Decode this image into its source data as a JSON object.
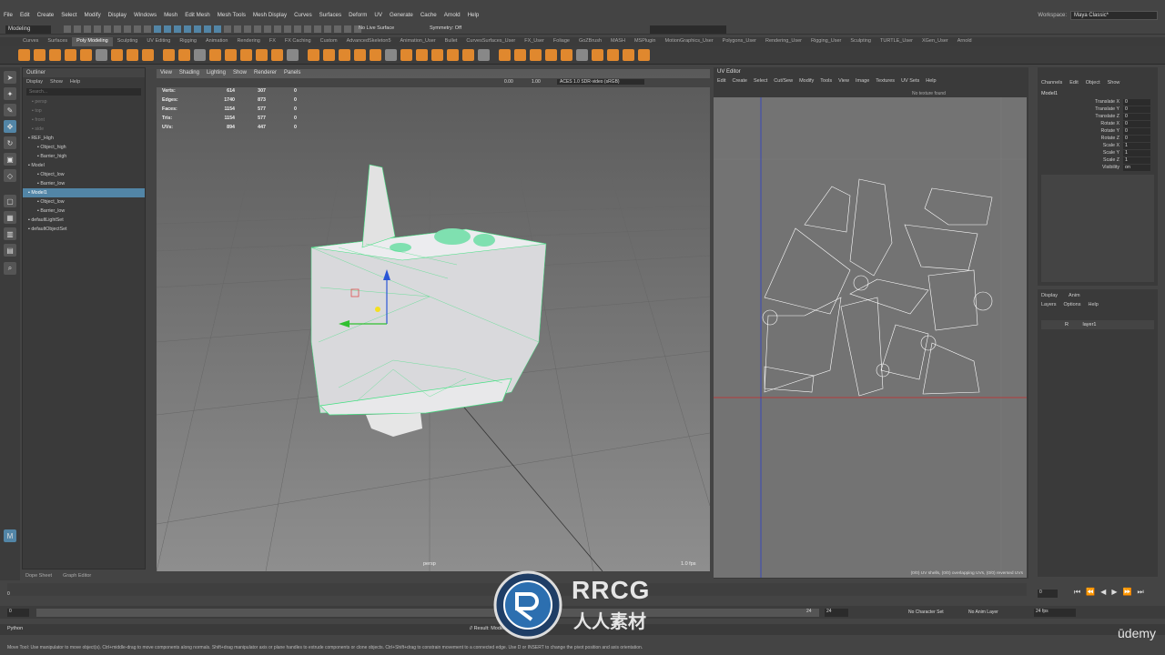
{
  "menubar": {
    "items": [
      "File",
      "Edit",
      "Create",
      "Select",
      "Modify",
      "Display",
      "Windows",
      "Mesh",
      "Edit Mesh",
      "Mesh Tools",
      "Mesh Display",
      "Curves",
      "Surfaces",
      "Deform",
      "UV",
      "Generate",
      "Cache",
      "Arnold",
      "Help"
    ],
    "workspace_label": "Workspace:",
    "workspace_value": "Maya Classic*"
  },
  "status_line": {
    "mode": "Modeling",
    "live_surface": "No Live Surface",
    "symmetry": "Symmetry: Off"
  },
  "shelf": {
    "tabs": [
      "Curves",
      "Surfaces",
      "Poly Modeling",
      "Sculpting",
      "UV Editing",
      "Rigging",
      "Animation",
      "Rendering",
      "FX",
      "FX Caching",
      "Custom",
      "AdvancedSkeleton5",
      "Animation_User",
      "Bullet",
      "CurvesSurfaces_User",
      "FX_User",
      "Foliage",
      "GoZBrush",
      "MASH",
      "MSPlugin",
      "MotionGraphics_User",
      "Polygons_User",
      "Rendering_User",
      "Rigging_User",
      "Sculpting",
      "TURTLE_User",
      "XGen_User",
      "Arnold"
    ],
    "active_tab": "Poly Modeling"
  },
  "outliner": {
    "title": "Outliner",
    "menu": [
      "Display",
      "Show",
      "Help"
    ],
    "search_placeholder": "Search...",
    "items": [
      {
        "label": "persp",
        "dim": true
      },
      {
        "label": "top",
        "dim": true
      },
      {
        "label": "front",
        "dim": true
      },
      {
        "label": "side",
        "dim": true
      },
      {
        "label": "REF_High",
        "dim": false
      },
      {
        "label": "Object_high",
        "dim": false
      },
      {
        "label": "Barrier_high",
        "dim": false
      },
      {
        "label": "Model",
        "dim": false
      },
      {
        "label": "Object_low",
        "dim": false
      },
      {
        "label": "Barrier_low",
        "dim": false
      },
      {
        "label": "Model1",
        "dim": false,
        "selected": true
      },
      {
        "label": "Object_low",
        "dim": false
      },
      {
        "label": "Barrier_low",
        "dim": false
      },
      {
        "label": "defaultLightSet",
        "dim": false
      },
      {
        "label": "defaultObjectSet",
        "dim": false
      }
    ]
  },
  "viewport": {
    "menu": [
      "View",
      "Shading",
      "Lighting",
      "Show",
      "Renderer",
      "Panels"
    ],
    "near_value": "0.00",
    "far_value": "1.00",
    "color_space": "ACES 1.0 SDR-video (sRGB)",
    "hud": [
      {
        "k": "Verts:",
        "a": "614",
        "b": "307",
        "c": "0"
      },
      {
        "k": "Edges:",
        "a": "1740",
        "b": "873",
        "c": "0"
      },
      {
        "k": "Faces:",
        "a": "1154",
        "b": "577",
        "c": "0"
      },
      {
        "k": "Tris:",
        "a": "1154",
        "b": "577",
        "c": "0"
      },
      {
        "k": "UVs:",
        "a": "894",
        "b": "447",
        "c": "0"
      }
    ],
    "camera_label": "persp",
    "fps": "1.0 fps"
  },
  "uv_editor": {
    "title": "UV Editor",
    "menu": [
      "Edit",
      "Create",
      "Select",
      "Cut/Sew",
      "Modify",
      "Tools",
      "View",
      "Image",
      "Textures",
      "UV Sets",
      "Help"
    ],
    "texture_text": "No texture found",
    "footer": "(0/0) UV shells, (0/0) overlapping UVs, (0/0) reversed UVs"
  },
  "channel_box": {
    "menu": [
      "Channels",
      "Edit",
      "Object",
      "Show"
    ],
    "object": "Model1",
    "attrs": [
      {
        "k": "Translate X",
        "v": "0"
      },
      {
        "k": "Translate Y",
        "v": "0"
      },
      {
        "k": "Translate Z",
        "v": "0"
      },
      {
        "k": "Rotate X",
        "v": "0"
      },
      {
        "k": "Rotate Y",
        "v": "0"
      },
      {
        "k": "Rotate Z",
        "v": "0"
      },
      {
        "k": "Scale X",
        "v": "1"
      },
      {
        "k": "Scale Y",
        "v": "1"
      },
      {
        "k": "Scale Z",
        "v": "1"
      },
      {
        "k": "Visibility",
        "v": "on"
      }
    ]
  },
  "layer_editor": {
    "tabs": [
      "Display",
      "Anim"
    ],
    "menu": [
      "Layers",
      "Options",
      "Help"
    ],
    "layer_flag": "R",
    "layer_name": "layer1"
  },
  "bottom_tabs": [
    "Dope Sheet",
    "Graph Editor"
  ],
  "timeline": {
    "start": "0",
    "start2": "0",
    "end1": "24",
    "end2": "24",
    "current": "0",
    "character": "No Character Set",
    "anim_layer": "No Anim Layer",
    "fps": "24 fps"
  },
  "command_line": {
    "language": "Python",
    "result": "// Result: Model"
  },
  "help_line": "Move Tool: Use manipulator to move object(s). Ctrl+middle-drag to move components along normals. Shift+drag manipulator axis or plane handles to extrude components or clone objects. Ctrl+Shift+drag to constrain movement to a connected edge. Use D or INSERT to change the pivot position and axis orientation.",
  "watermark": {
    "brand": "RRCG",
    "chinese": "人人素材",
    "udemy": "ūdemy"
  },
  "colors": {
    "accent": "#5285a6",
    "shelf_orange": "#e0882e",
    "wire_green": "#40e080"
  }
}
